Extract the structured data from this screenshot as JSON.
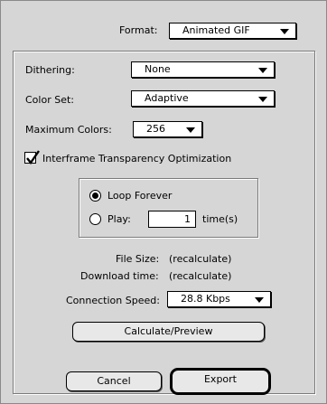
{
  "format": {
    "label": "Format:",
    "value": "Animated GIF"
  },
  "dithering": {
    "label": "Dithering:",
    "value": "None"
  },
  "color_set": {
    "label": "Color Set:",
    "value": "Adaptive"
  },
  "max_colors": {
    "label": "Maximum Colors:",
    "value": "256"
  },
  "interframe": {
    "label": "Interframe Transparency Optimization",
    "checked": true
  },
  "loop": {
    "forever_label": "Loop Forever",
    "play_label": "Play:",
    "play_value": "1",
    "times_label": "time(s)",
    "selected": "forever"
  },
  "file_size": {
    "label": "File Size:",
    "value": "(recalculate)"
  },
  "download_time": {
    "label": "Download time:",
    "value": "(recalculate)"
  },
  "connection_speed": {
    "label": "Connection Speed:",
    "value": "28.8 Kbps"
  },
  "buttons": {
    "calculate": "Calculate/Preview",
    "cancel": "Cancel",
    "export": "Export"
  }
}
